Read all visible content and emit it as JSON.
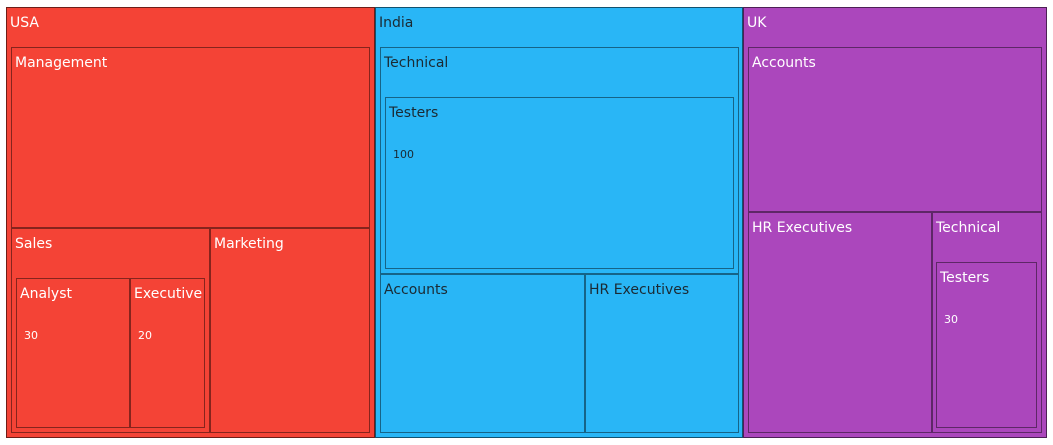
{
  "chart_data": {
    "type": "treemap",
    "colors": {
      "USA": "#f44336",
      "India": "#29b6f6",
      "UK": "#ab47bc"
    },
    "label_colors": {
      "USA": "#ffffff",
      "India": "#1b2a33",
      "UK": "#ffffff"
    },
    "data": [
      {
        "name": "USA",
        "children": [
          {
            "name": "Management"
          },
          {
            "name": "Sales",
            "children": [
              {
                "name": "Analyst",
                "value": 30
              },
              {
                "name": "Executive",
                "value": 20
              }
            ]
          },
          {
            "name": "Marketing"
          }
        ]
      },
      {
        "name": "India",
        "children": [
          {
            "name": "Technical",
            "children": [
              {
                "name": "Testers",
                "value": 100
              }
            ]
          },
          {
            "name": "Accounts"
          },
          {
            "name": "HR Executives"
          }
        ]
      },
      {
        "name": "UK",
        "children": [
          {
            "name": "Accounts"
          },
          {
            "name": "HR Executives"
          },
          {
            "name": "Technical",
            "children": [
              {
                "name": "Testers",
                "value": 30
              }
            ]
          }
        ]
      }
    ]
  }
}
